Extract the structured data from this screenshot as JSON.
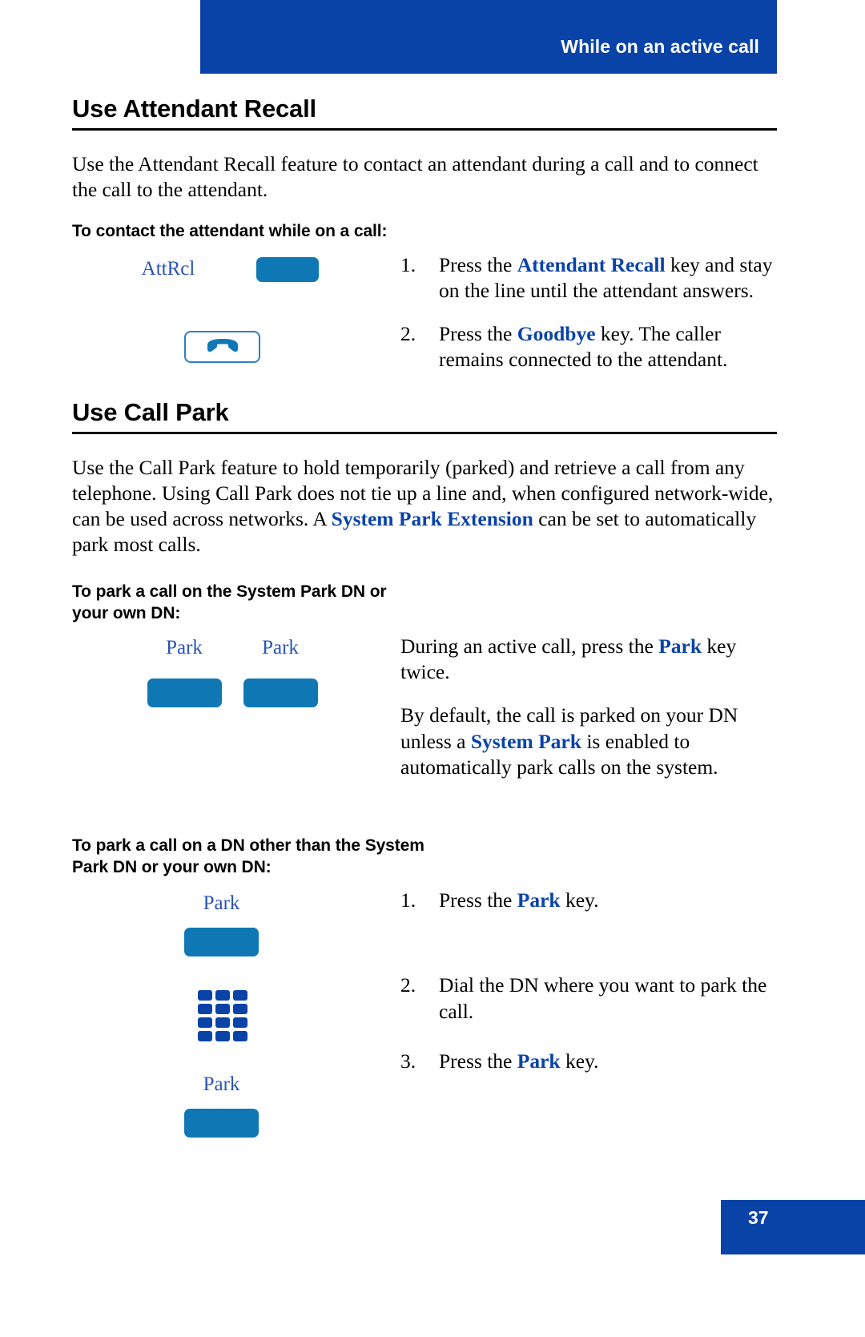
{
  "header": {
    "title": "While on an active call",
    "bg_color": "#0a43a8"
  },
  "colors": {
    "header_blue": "#0a43a8",
    "emphasis_blue": "#0a43a8",
    "key_fill_blue": "#0f78b4",
    "key_label_blue": "#2b54b8",
    "key_outline_blue": "#2f7fc0"
  },
  "sections": [
    {
      "id": "attendant-recall",
      "title": "Use Attendant Recall",
      "intro": {
        "part1": "Use the Attendant Recall feature to contact an attendant during a call and to connect the call to the attendant."
      },
      "subhead": "To contact the attendant while on a call:",
      "keys": [
        {
          "label": "AttRcl",
          "type": "soft-key"
        },
        {
          "label": "",
          "type": "goodbye-key",
          "icon": "handset-icon"
        }
      ],
      "steps": [
        {
          "num": "1.",
          "pre": "Press the ",
          "emph": "Attendant Recall",
          "post": " key and stay on the line until the attendant answers."
        },
        {
          "num": "2.",
          "pre": "Press the ",
          "emph": "Goodbye",
          "post": " key. The caller remains connected to the attendant."
        }
      ]
    },
    {
      "id": "call-park",
      "title": "Use Call Park",
      "intro": {
        "pre": "Use the Call Park feature to hold temporarily (parked) and retrieve a call from any telephone. Using Call Park does not tie up a line and, when configured network-wide, can be used across networks. A ",
        "emph": "System Park Extension",
        "post": " can be set to automatically park most calls."
      },
      "proc_a": {
        "subhead": "To park a call on the System Park DN or your own DN:",
        "keys": [
          {
            "label": "Park",
            "type": "soft-key"
          },
          {
            "label": "Park",
            "type": "soft-key"
          }
        ],
        "paragraphs": [
          {
            "pre": "During an active call, press the ",
            "emph": "Park",
            "post": " key twice."
          },
          {
            "pre": "By default, the call is parked on your DN unless a ",
            "emph": "System Park",
            "post": " is enabled to automatically park calls on the system."
          }
        ]
      },
      "proc_b": {
        "subhead": "To park a call on a DN other than the System Park DN or your own DN:",
        "keys": [
          {
            "label": "Park",
            "type": "soft-key"
          },
          {
            "label": "",
            "type": "keypad",
            "icon": "keypad-icon"
          },
          {
            "label": "Park",
            "type": "soft-key"
          }
        ],
        "steps": [
          {
            "num": "1.",
            "pre": "Press the ",
            "emph": "Park",
            "post": " key."
          },
          {
            "num": "2.",
            "pre": "Dial the DN where you want to park the call.",
            "emph": "",
            "post": ""
          },
          {
            "num": "3.",
            "pre": "Press the ",
            "emph": "Park",
            "post": " key."
          }
        ]
      }
    }
  ],
  "footer": {
    "page_number": "37"
  }
}
